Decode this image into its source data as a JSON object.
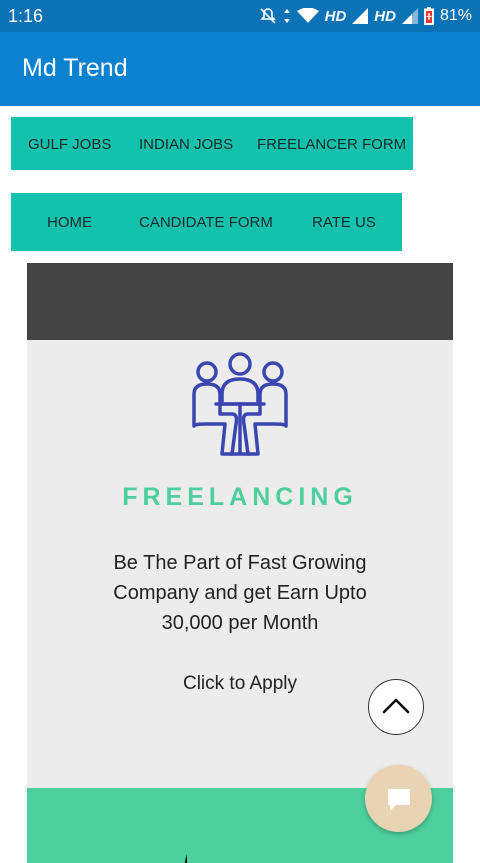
{
  "status_bar": {
    "time": "1:16",
    "network_label_1": "HD",
    "network_label_2": "HD",
    "battery": "81%"
  },
  "app_bar": {
    "title": "Md Trend",
    "color": "#0b82cf"
  },
  "nav": {
    "row1": [
      "GULF JOBS",
      "INDIAN JOBS",
      "FREELANCER FORM"
    ],
    "row2": [
      "HOME",
      "CANDIDATE FORM",
      "RATE US"
    ],
    "color": "#14c1ac"
  },
  "card": {
    "icon": "meeting-table-icon",
    "heading": "FREELANCING",
    "text": "Be The Part of  Fast Growing Company and get Earn Upto 30,000 per Month",
    "apply": "Click to Apply",
    "accent": "#4ccf9d"
  },
  "floating": {
    "scroll_top_icon": "chevron-up-icon",
    "chat_icon": "chat-bubble-icon"
  }
}
